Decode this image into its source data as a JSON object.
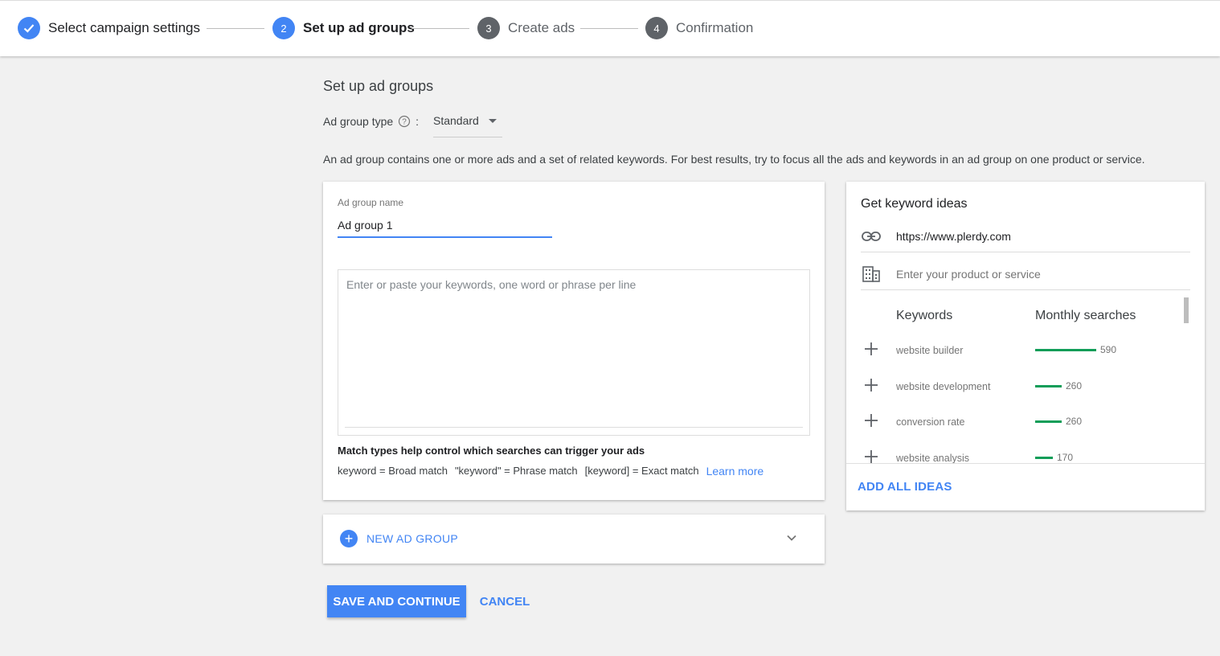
{
  "stepper": {
    "steps": [
      {
        "number": "",
        "label": "Select campaign settings",
        "state": "done"
      },
      {
        "number": "2",
        "label": "Set up ad groups",
        "state": "active"
      },
      {
        "number": "3",
        "label": "Create ads",
        "state": "pending"
      },
      {
        "number": "4",
        "label": "Confirmation",
        "state": "pending"
      }
    ]
  },
  "page": {
    "title": "Set up ad groups",
    "ad_group_type_label": "Ad group type",
    "ad_group_type_colon": ":",
    "ad_group_type_value": "Standard",
    "description": "An ad group contains one or more ads and a set of related keywords. For best results, try to focus all the ads and keywords in an ad group on one product or service."
  },
  "ad_group": {
    "name_label": "Ad group name",
    "name_value": "Ad group 1",
    "keywords_placeholder": "Enter or paste your keywords, one word or phrase per line",
    "match_title": "Match types help control which searches can trigger your ads",
    "match_broad": "keyword = Broad match",
    "match_phrase": "\"keyword\" = Phrase match",
    "match_exact": "[keyword] = Exact match",
    "learn_more": "Learn more"
  },
  "new_ad_group": {
    "label": "NEW AD GROUP"
  },
  "actions": {
    "save": "SAVE AND CONTINUE",
    "cancel": "CANCEL"
  },
  "ideas": {
    "title": "Get keyword ideas",
    "url_value": "https://www.plerdy.com",
    "product_placeholder": "Enter your product or service",
    "col_keywords": "Keywords",
    "col_monthly": "Monthly searches",
    "keywords": [
      {
        "name": "website builder",
        "searches": "590",
        "level": 590
      },
      {
        "name": "website development",
        "searches": "260",
        "level": 260
      },
      {
        "name": "conversion rate",
        "searches": "260",
        "level": 260
      },
      {
        "name": "website analysis",
        "searches": "170",
        "level": 170
      }
    ],
    "add_all": "ADD ALL IDEAS"
  },
  "colors": {
    "accent": "#4285f4",
    "bar": "#0f9d58",
    "step_pending": "#5f6368"
  }
}
